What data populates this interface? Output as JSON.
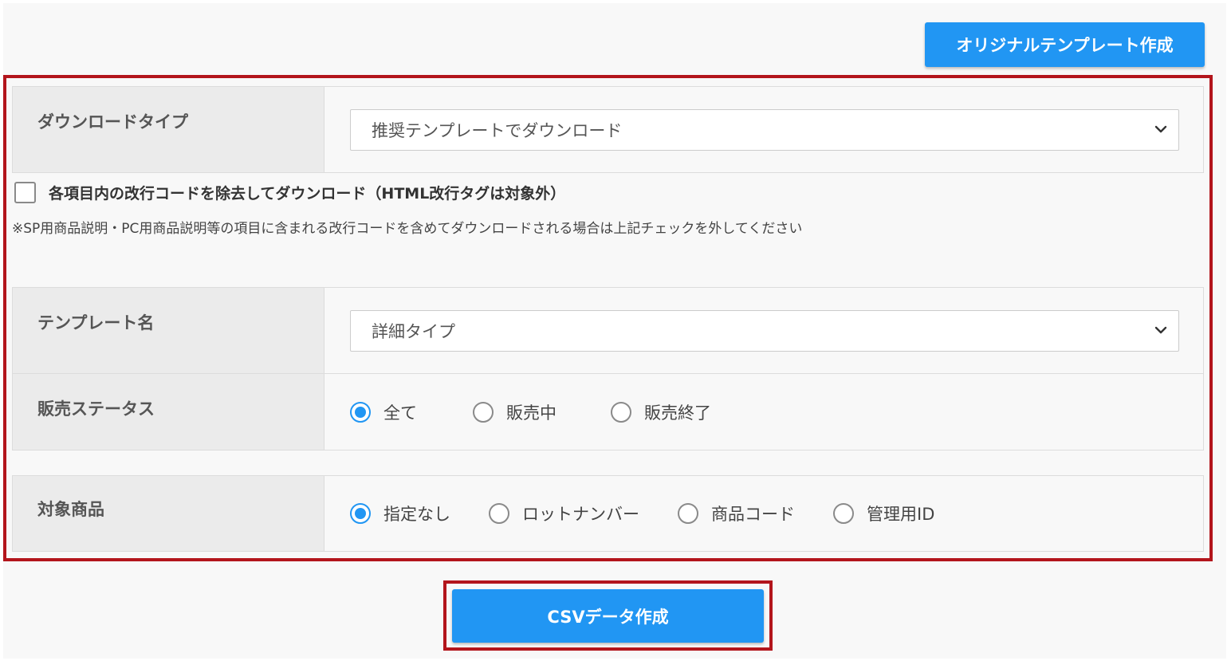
{
  "header": {
    "original_template_button": "オリジナルテンプレート作成"
  },
  "form": {
    "download_type": {
      "label": "ダウンロードタイプ",
      "selected": "推奨テンプレートでダウンロード"
    },
    "remove_linebreak": {
      "label": "各項目内の改行コードを除去してダウンロード（HTML改行タグは対象外）",
      "checked": false,
      "note": "※SP用商品説明・PC用商品説明等の項目に含まれる改行コードを含めてダウンロードされる場合は上記チェックを外してください"
    },
    "template_name": {
      "label": "テンプレート名",
      "selected": "詳細タイプ"
    },
    "sales_status": {
      "label": "販売ステータス",
      "options": [
        "全て",
        "販売中",
        "販売終了"
      ],
      "selected": "全て"
    },
    "target_product": {
      "label": "対象商品",
      "options": [
        "指定なし",
        "ロットナンバー",
        "商品コード",
        "管理用ID"
      ],
      "selected": "指定なし"
    }
  },
  "footer": {
    "csv_button": "CSVデータ作成"
  },
  "colors": {
    "primary_button": "#2196f3",
    "highlight_frame": "#b3151c",
    "label_cell_bg": "#ebebeb",
    "radio_checked": "#2196f3"
  },
  "icons": {
    "select_arrow": "chevron-down-icon"
  }
}
